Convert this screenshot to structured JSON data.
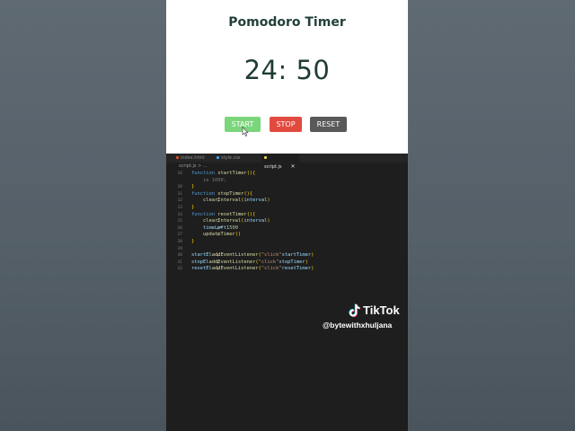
{
  "app": {
    "title": "Pomodoro Timer",
    "timer": "24: 50",
    "buttons": {
      "start": "START",
      "stop": "STOP",
      "reset": "RESET"
    },
    "colors": {
      "start": "#7bd67b",
      "stop": "#e34a3f",
      "reset": "#595959"
    }
  },
  "editor": {
    "tabs": [
      {
        "label": "index.html",
        "icon": "html-file-icon"
      },
      {
        "label": "style.css",
        "icon": "css-file-icon"
      },
      {
        "label": "script.js",
        "icon": "js-file-icon",
        "active": true
      }
    ],
    "close_glyph": "✕",
    "breadcrumb": "script.js > ...",
    "lines": [
      {
        "n": "16",
        "parts": [
          [
            "kw",
            "function "
          ],
          [
            "fn",
            "startTimer"
          ],
          [
            "pn",
            "(){"
          ]
        ]
      },
      {
        "n": "",
        "parts": [
          [
            "fade",
            "    ie 1000;"
          ]
        ]
      },
      {
        "n": "30",
        "parts": [
          [
            "pn",
            "}"
          ]
        ]
      },
      {
        "n": "31",
        "parts": [
          [
            "kw",
            "function "
          ],
          [
            "fn",
            "stopTimer"
          ],
          [
            "pn",
            "(){"
          ]
        ]
      },
      {
        "n": "32",
        "parts": [
          [
            "fn",
            "    clearInterval"
          ],
          [
            "pn",
            "("
          ],
          [
            "vr",
            "interval"
          ],
          [
            "pn",
            ")"
          ],
          [
            "tx",
            ";"
          ]
        ]
      },
      {
        "n": "33",
        "parts": [
          [
            "pn",
            "}"
          ]
        ]
      },
      {
        "n": "34",
        "parts": [
          [
            "kw",
            "function "
          ],
          [
            "fn",
            "resetTimer"
          ],
          [
            "pn",
            "(){"
          ]
        ]
      },
      {
        "n": "35",
        "parts": [
          [
            "fn",
            "    clearInterval"
          ],
          [
            "pn",
            "("
          ],
          [
            "vr",
            "interval"
          ],
          [
            "pn",
            ")"
          ],
          [
            "tx",
            ";"
          ]
        ]
      },
      {
        "n": "36",
        "parts": [
          [
            "vr",
            "    timeLeft"
          ],
          [
            "tx",
            " = "
          ],
          [
            "nm",
            "1500"
          ],
          [
            "tx",
            ";"
          ]
        ]
      },
      {
        "n": "37",
        "parts": [
          [
            "fn",
            "    updateTimer"
          ],
          [
            "pn",
            "()"
          ],
          [
            "tx",
            ";"
          ]
        ]
      },
      {
        "n": "38",
        "parts": [
          [
            "pn",
            "}"
          ]
        ]
      },
      {
        "n": "39",
        "parts": []
      },
      {
        "n": "40",
        "parts": [
          [
            "vr",
            "startEl"
          ],
          [
            "tx",
            "."
          ],
          [
            "fn",
            "addEventListener"
          ],
          [
            "pn",
            "("
          ],
          [
            "st",
            "\"click\""
          ],
          [
            "tx",
            ", "
          ],
          [
            "vr",
            "startTimer"
          ],
          [
            "pn",
            ")"
          ]
        ]
      },
      {
        "n": "41",
        "parts": [
          [
            "vr",
            "stopEl"
          ],
          [
            "tx",
            "."
          ],
          [
            "fn",
            "addEventListener"
          ],
          [
            "pn",
            "("
          ],
          [
            "st",
            "\"click\""
          ],
          [
            "tx",
            ", "
          ],
          [
            "vr",
            "stopTimer"
          ],
          [
            "pn",
            ")"
          ]
        ]
      },
      {
        "n": "42",
        "parts": [
          [
            "vr",
            "resetEl"
          ],
          [
            "tx",
            "."
          ],
          [
            "fn",
            "addEventListener"
          ],
          [
            "pn",
            "("
          ],
          [
            "st",
            "\"click\""
          ],
          [
            "tx",
            ", "
          ],
          [
            "vr",
            "resetTimer"
          ],
          [
            "pn",
            ")"
          ]
        ]
      }
    ]
  },
  "watermark": {
    "brand": "TikTok",
    "handle": "@bytewithxhuljana",
    "logo_icon": "tiktok-logo-icon"
  }
}
